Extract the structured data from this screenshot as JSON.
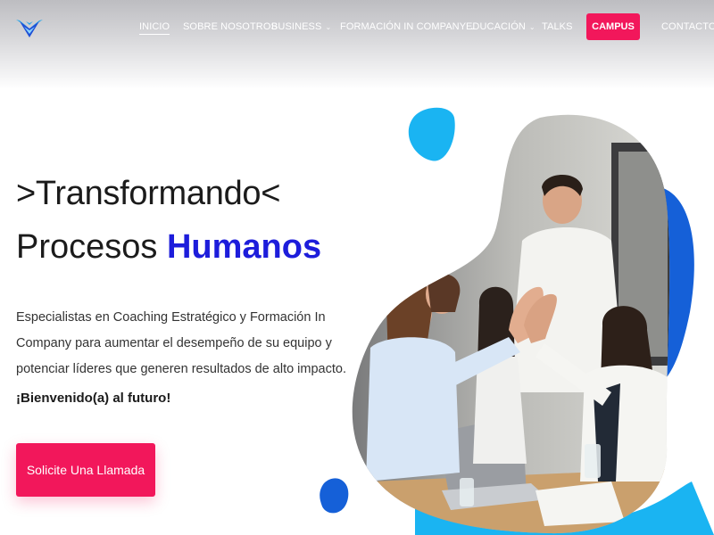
{
  "header": {
    "nav": [
      {
        "label": "INICIO",
        "active": true,
        "dropdown": false
      },
      {
        "label": "SOBRE NOSOTROS",
        "active": false,
        "dropdown": false
      },
      {
        "label": "BUSINESS",
        "active": false,
        "dropdown": true
      },
      {
        "label": "FORMACIÓN IN COMPANY",
        "active": false,
        "dropdown": true
      },
      {
        "label": "EDUCACIÓN",
        "active": false,
        "dropdown": true
      },
      {
        "label": "TALKS",
        "active": false,
        "dropdown": false
      },
      {
        "label": "CAMPUS",
        "active": false,
        "dropdown": false
      },
      {
        "label": "CONTACTO",
        "active": false,
        "dropdown": false
      }
    ],
    "logo_icon": "geometric-bird-logo-icon",
    "dropdown_icon": "chevron-down-icon"
  },
  "hero": {
    "line1": ">Transformando<",
    "line2_prefix": "Procesos ",
    "line2_accent": "Humanos",
    "description": "Especialistas en Coaching Estratégico y Formación In Company para aumentar el desempeño de su equipo y potenciar líderes que generen resultados de alto impacto.",
    "welcome": "¡Bienvenido(a) al futuro!",
    "cta_label": "Solicite Una Llamada",
    "image_subject": "team-high-five-photo"
  },
  "colors": {
    "accent_pink": "#f2175b",
    "accent_blue": "#1d1ddb",
    "blob_light_blue": "#1ab4f2",
    "blob_dark_blue": "#1560d8"
  }
}
